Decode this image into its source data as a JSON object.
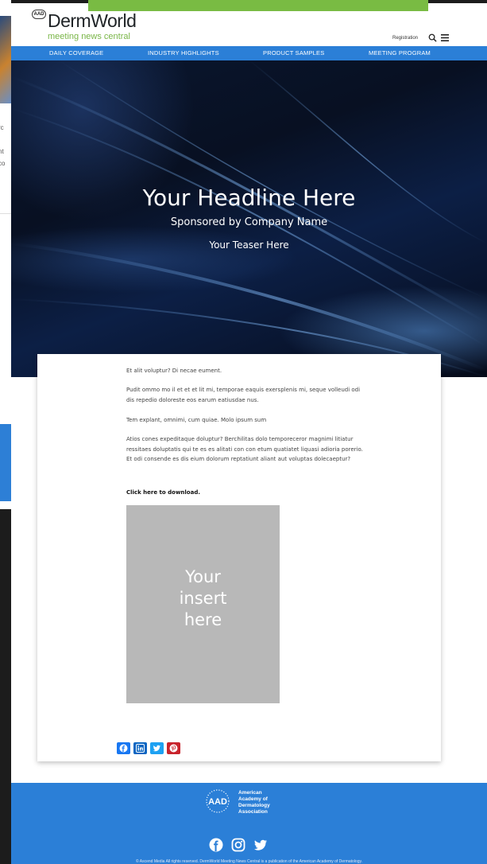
{
  "background_page": {
    "snippets": [
      "rc",
      "nt",
      "co"
    ]
  },
  "header": {
    "logo_badge": "AAD",
    "logo_title": "DermWorld",
    "logo_subtitle": "meeting news central",
    "registration": "Registration"
  },
  "nav": {
    "items": [
      "Daily Coverage",
      "Industry Highlights",
      "Product Samples",
      "Meeting Program"
    ]
  },
  "hero": {
    "headline": "Your Headline Here",
    "sponsor": "Sponsored by Company Name",
    "teaser": "Your Teaser Here"
  },
  "article": {
    "paragraphs": [
      "Et alit voluptur? Di necae eument.",
      "Pudit ommo mo il et et et lit mi, temporae eaquis exersplenis mi, seque volleudi odi dis repedio doloreste eos earum eatiusdae nus.",
      "Tem explant, omnimi, cum quiae. Molo ipsum sum",
      "Atios cones expeditaque doluptur? Berchilitas dolo temporeceror magnimi litiatur ressitaes doluptatis qui te es es alitati con con etum quatiatet liquasi adioria porerio. Et odi consende es dis eium dolorum reptatiunt aliant aut voluptas dolecaeptur?"
    ],
    "download_link": "Click here to download.",
    "insert_placeholder": "Your\ninsert\nhere"
  },
  "share": {
    "icons": [
      "facebook-icon",
      "linkedin-icon",
      "twitter-icon",
      "pinterest-icon"
    ],
    "colors": [
      "#1877f2",
      "#0a66c2",
      "#1da1f2",
      "#c8232c"
    ]
  },
  "footer": {
    "logo_text": "AAD",
    "org_name_lines": [
      "American",
      "Academy of",
      "Dermatology",
      "Association"
    ],
    "social_icons": [
      "facebook-icon",
      "instagram-icon",
      "twitter-icon"
    ],
    "copyright": "© Ascend Media All rights reserved. DermWorld Meeting News Central is a publication of the American Academy of Dermatology."
  },
  "colors": {
    "brand_blue": "#2b7fd7",
    "brand_green": "#79bb43",
    "hero_dark": "#081022"
  }
}
